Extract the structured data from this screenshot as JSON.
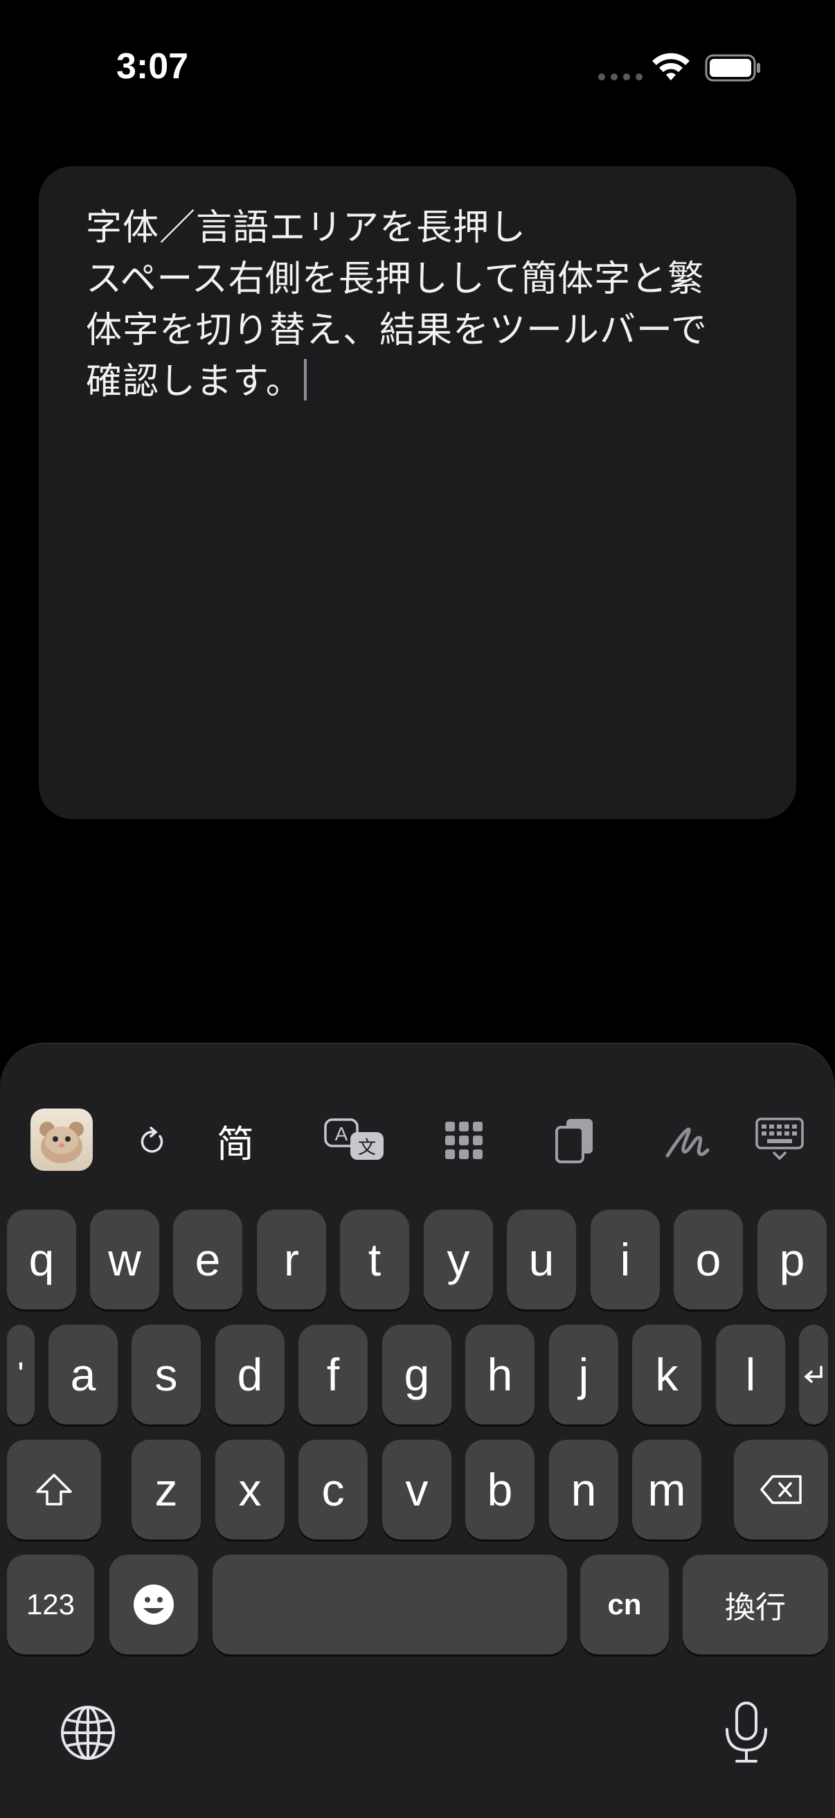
{
  "status_bar": {
    "time": "3:07"
  },
  "note": {
    "line1": "字体／言語エリアを長押し",
    "line2": "スペース右側を長押しして簡体字と繁",
    "line3": "体字を切り替え、結果をツールバーで",
    "line4": "確認します。"
  },
  "toolbar": {
    "app_icon": "hamster-app-icon",
    "refresh_icon": "refresh-icon",
    "script_label": "简",
    "translate_icon": "translate-icon",
    "grid_icon": "grid-icon",
    "clipboard_icon": "clipboard-icon",
    "handwriting_icon": "handwriting-icon",
    "keyboard_hide_icon": "keyboard-hide-icon"
  },
  "keyboard": {
    "row1": [
      "q",
      "w",
      "e",
      "r",
      "t",
      "y",
      "u",
      "i",
      "o",
      "p"
    ],
    "row2": [
      "a",
      "s",
      "d",
      "f",
      "g",
      "h",
      "j",
      "k",
      "l"
    ],
    "row2_left": "'",
    "row3": [
      "z",
      "x",
      "c",
      "v",
      "b",
      "n",
      "m"
    ],
    "numbers_label": "123",
    "cn_label": "cn",
    "return_label": "換行",
    "space_label": ""
  },
  "colors": {
    "key_bg": "#434345",
    "keyboard_bg": "#1f1f21",
    "card_bg": "#1c1c1e"
  }
}
